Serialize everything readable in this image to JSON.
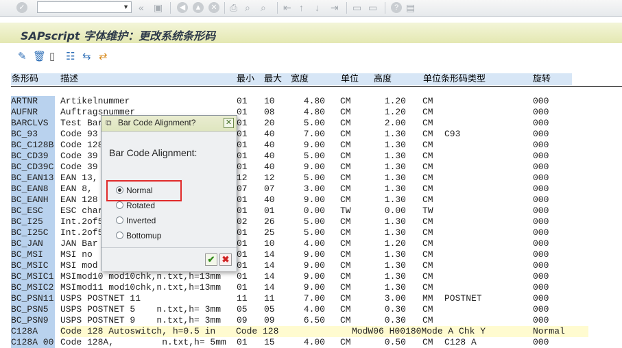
{
  "toolbar": {
    "command_field_value": "",
    "icons": [
      "enter-icon",
      "back-icon",
      "save-icon",
      "exit-icon",
      "cancel-icon",
      "print-icon",
      "find-icon",
      "find-next-icon",
      "first-page-icon",
      "prev-page-icon",
      "next-page-icon",
      "last-page-icon",
      "new-session-icon",
      "shortcut-icon",
      "help-icon",
      "customize-icon"
    ]
  },
  "page": {
    "title": "SAPscript 字体维护：更改系统条形码"
  },
  "app_toolbar": {
    "icons": [
      "edit-icon",
      "delete-icon",
      "new-icon",
      "list-icon",
      "hierarchy-icon",
      "transport-icon"
    ]
  },
  "list": {
    "headers": {
      "code": "条形码",
      "desc": "描述",
      "min": "最小",
      "max": "最大",
      "width": "宽度",
      "unit": "单位",
      "height": "高度",
      "unit_type": "单位条形码类型",
      "rotation": "旋转"
    },
    "rows": [
      {
        "code": "ARTNR",
        "desc": "Artikelnummer",
        "min": "01",
        "max": "10",
        "width": "4.80",
        "unit": "CM",
        "height": "1.20",
        "uu": "CM",
        "type": "",
        "rot": "000"
      },
      {
        "code": "AUFNR",
        "desc": "Auftragsnummer",
        "min": "01",
        "max": "08",
        "width": "4.80",
        "unit": "CM",
        "height": "1.20",
        "uu": "CM",
        "type": "",
        "rot": "000"
      },
      {
        "code": "BARCLVS",
        "desc": "Test Bar",
        "min": "01",
        "max": "20",
        "width": "5.00",
        "unit": "CM",
        "height": "2.00",
        "uu": "CM",
        "type": "",
        "rot": "000"
      },
      {
        "code": "BC_93",
        "desc": "Code 93",
        "min": "01",
        "max": "40",
        "width": "7.00",
        "unit": "CM",
        "height": "1.30",
        "uu": "CM",
        "type": "C93",
        "rot": "000"
      },
      {
        "code": "BC_C128B",
        "desc": "Code 128",
        "min": "01",
        "max": "40",
        "width": "9.00",
        "unit": "CM",
        "height": "1.30",
        "uu": "CM",
        "type": "",
        "rot": "000"
      },
      {
        "code": "BC_CD39",
        "desc": "Code 39",
        "min": "01",
        "max": "40",
        "width": "5.00",
        "unit": "CM",
        "height": "1.30",
        "uu": "CM",
        "type": "",
        "rot": "000"
      },
      {
        "code": "BC_CD39C",
        "desc": "Code 39",
        "min": "01",
        "max": "40",
        "width": "9.00",
        "unit": "CM",
        "height": "1.30",
        "uu": "CM",
        "type": "",
        "rot": "000"
      },
      {
        "code": "BC_EAN13",
        "desc": "EAN 13,",
        "min": "12",
        "max": "12",
        "width": "5.00",
        "unit": "CM",
        "height": "1.30",
        "uu": "CM",
        "type": "",
        "rot": "000"
      },
      {
        "code": "BC_EAN8",
        "desc": "EAN 8,",
        "min": "07",
        "max": "07",
        "width": "3.00",
        "unit": "CM",
        "height": "1.30",
        "uu": "CM",
        "type": "",
        "rot": "000"
      },
      {
        "code": "BC_EANH",
        "desc": "EAN 128",
        "min": "01",
        "max": "40",
        "width": "9.00",
        "unit": "CM",
        "height": "1.30",
        "uu": "CM",
        "type": "",
        "rot": "000"
      },
      {
        "code": "BC_ESC",
        "desc": "ESC char",
        "min": "01",
        "max": "01",
        "width": "0.00",
        "unit": "TW",
        "height": "0.00",
        "uu": "TW",
        "type": "",
        "rot": "000"
      },
      {
        "code": "BC_I25",
        "desc": "Int.2of5",
        "min": "02",
        "max": "26",
        "width": "5.00",
        "unit": "CM",
        "height": "1.30",
        "uu": "CM",
        "type": "",
        "rot": "000"
      },
      {
        "code": "BC_I25C",
        "desc": "Int.2of5",
        "min": "01",
        "max": "25",
        "width": "5.00",
        "unit": "CM",
        "height": "1.30",
        "uu": "CM",
        "type": "",
        "rot": "000"
      },
      {
        "code": "BC_JAN",
        "desc": "JAN Bar",
        "min": "01",
        "max": "10",
        "width": "4.00",
        "unit": "CM",
        "height": "1.20",
        "uu": "CM",
        "type": "",
        "rot": "000"
      },
      {
        "code": "BC_MSI",
        "desc": "MSI no",
        "min": "01",
        "max": "14",
        "width": "9.00",
        "unit": "CM",
        "height": "1.30",
        "uu": "CM",
        "type": "",
        "rot": "000"
      },
      {
        "code": "BC_MSIC",
        "desc": "MSI mod",
        "min": "01",
        "max": "14",
        "width": "9.00",
        "unit": "CM",
        "height": "1.30",
        "uu": "CM",
        "type": "",
        "rot": "000"
      },
      {
        "code": "BC_MSIC1",
        "desc": "MSImod10 mod10chk,n.txt,h=13mm",
        "min": "01",
        "max": "14",
        "width": "9.00",
        "unit": "CM",
        "height": "1.30",
        "uu": "CM",
        "type": "",
        "rot": "000"
      },
      {
        "code": "BC_MSIC2",
        "desc": "MSImod11 mod10chk,n.txt,h=13mm",
        "min": "01",
        "max": "14",
        "width": "9.00",
        "unit": "CM",
        "height": "1.30",
        "uu": "CM",
        "type": "",
        "rot": "000"
      },
      {
        "code": "BC_PSN11",
        "desc": "USPS POSTNET 11",
        "min": "11",
        "max": "11",
        "width": "7.00",
        "unit": "CM",
        "height": "3.00",
        "uu": "MM",
        "type": "POSTNET",
        "rot": "000"
      },
      {
        "code": "BC_PSN5",
        "desc": "USPS POSTNET 5    n.txt,h= 3mm",
        "min": "05",
        "max": "05",
        "width": "4.00",
        "unit": "CM",
        "height": "0.30",
        "uu": "CM",
        "type": "",
        "rot": "000"
      },
      {
        "code": "BC_PSN9",
        "desc": "USPS POSTNET 9    n.txt,h= 3mm",
        "min": "09",
        "max": "09",
        "width": "6.50",
        "unit": "CM",
        "height": "0.30",
        "uu": "CM",
        "type": "",
        "rot": "000"
      },
      {
        "code": "C128A",
        "desc": "Code 128 Autoswitch, h=0.5 in",
        "min": "Code 128",
        "max": "",
        "width": "",
        "unit": "ModW06 H00180Mode A Chk Y",
        "height": "",
        "uu": "",
        "type": "",
        "rot": "Normal",
        "highlight": true
      },
      {
        "code": "C128A 00",
        "desc": "Code 128A,         n.txt,h= 5mm",
        "min": "01",
        "max": "15",
        "width": "4.00",
        "unit": "CM",
        "height": "0.50",
        "uu": "CM",
        "type": "C128 A",
        "rot": "000"
      }
    ]
  },
  "dialog": {
    "title": "Bar Code Alignment?",
    "heading": "Bar Code Alignment:",
    "options": [
      {
        "label": "Normal",
        "selected": true
      },
      {
        "label": "Rotated",
        "selected": false
      },
      {
        "label": "Inverted",
        "selected": false
      },
      {
        "label": "Bottomup",
        "selected": false
      }
    ],
    "ok_icon": "checkmark-icon",
    "cancel_icon": "cancel-x-icon"
  }
}
